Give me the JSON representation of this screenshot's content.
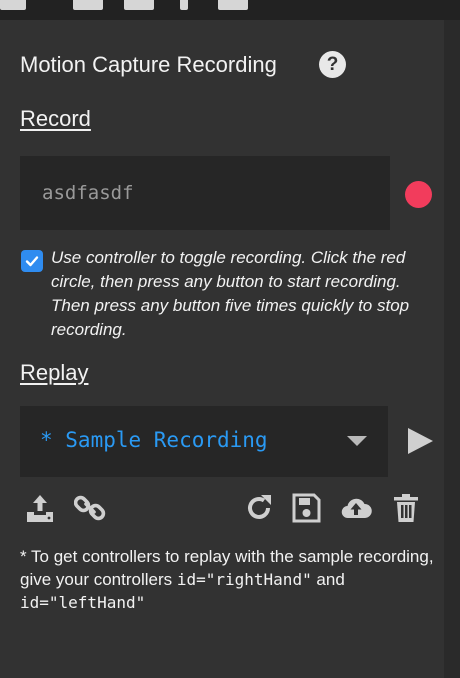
{
  "panel": {
    "title": "Motion Capture Recording",
    "help_label": "?"
  },
  "record": {
    "heading": "Record",
    "name_value": "asdfasdf",
    "record_color": "#f23c5c",
    "toggle_checked": true,
    "toggle_label": "Use controller to toggle recording. Click the red circle, then press any button to start recording. Then press any button five times quickly to stop recording."
  },
  "replay": {
    "heading": "Replay",
    "selected_recording": "* Sample Recording",
    "accent_color": "#2a9af4"
  },
  "toolbar": {
    "icons": [
      "upload-icon",
      "link-icon",
      "refresh-icon",
      "save-icon",
      "cloud-upload-icon",
      "trash-icon"
    ]
  },
  "note": {
    "prefix": "* To get controllers to replay with the sample recording, give your controllers ",
    "code_right": "id=\"rightHand\"",
    "and": " and ",
    "code_left": "id=\"leftHand\""
  }
}
